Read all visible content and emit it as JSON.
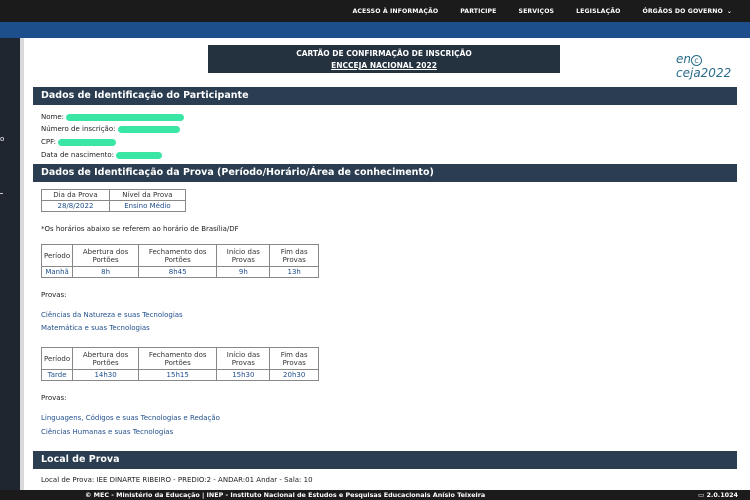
{
  "topnav": {
    "items": [
      "ACESSO À INFORMAÇÃO",
      "PARTICIPE",
      "SERVIÇOS",
      "LEGISLAÇÃO",
      "ÓRGÃOS DO GOVERNO"
    ]
  },
  "header": {
    "title": "CARTÃO DE CONFIRMAÇÃO DE INSCRIÇÃO",
    "subtitle": "ENCCEJA NACIONAL 2022",
    "logo": "encceja2022"
  },
  "participant": {
    "section_title": "Dados de Identificação do Participante",
    "name_label": "Nome:",
    "inscricao_label": "Número de inscrição:",
    "cpf_label": "CPF:",
    "nascimento_label": "Data de nascimento:"
  },
  "prova": {
    "section_title": "Dados de Identificação da Prova (Período/Horário/Área de conhecimento)",
    "dia_header": "Dia da Prova",
    "nivel_header": "Nível da Prova",
    "dia": "28/8/2022",
    "nivel": "Ensino Médio",
    "horario_note": "*Os horários abaixo se referem ao horário de Brasília/DF",
    "col_periodo": "Período",
    "col_abertura": "Abertura dos Portões",
    "col_fechamento": "Fechamento dos Portões",
    "col_inicio": "Início das Provas",
    "col_fim": "Fim das Provas",
    "manha": {
      "periodo": "Manhã",
      "abertura": "8h",
      "fechamento": "8h45",
      "inicio": "9h",
      "fim": "13h"
    },
    "provas_label_1": "Provas:",
    "provas_manha": [
      "Ciências da Natureza e suas Tecnologias",
      "Matemática e suas Tecnologias"
    ],
    "tarde": {
      "periodo": "Tarde",
      "abertura": "14h30",
      "fechamento": "15h15",
      "inicio": "15h30",
      "fim": "20h30"
    },
    "provas_label_2": "Provas:",
    "provas_tarde": [
      "Linguagens, Códigos e suas Tecnologias e Redação",
      "Ciências Humanas e suas Tecnologias"
    ]
  },
  "local": {
    "section_title": "Local de Prova",
    "text": "Local de Prova: IEE DINARTE RIBEIRO - PREDIO:2 - ANDAR:01 Andar - Sala: 10"
  },
  "footer": {
    "text": "© MEC - Ministério da Educação | INEP - Instituto Nacional de Estudos e Pesquisas Educacionais Anísio Teixeira",
    "version": "2.0.1024"
  },
  "colors": {
    "topbar": "#1b1b1b",
    "bluebar": "#1c4f8c",
    "section": "#2b3d50",
    "redaction": "#25e39a"
  }
}
